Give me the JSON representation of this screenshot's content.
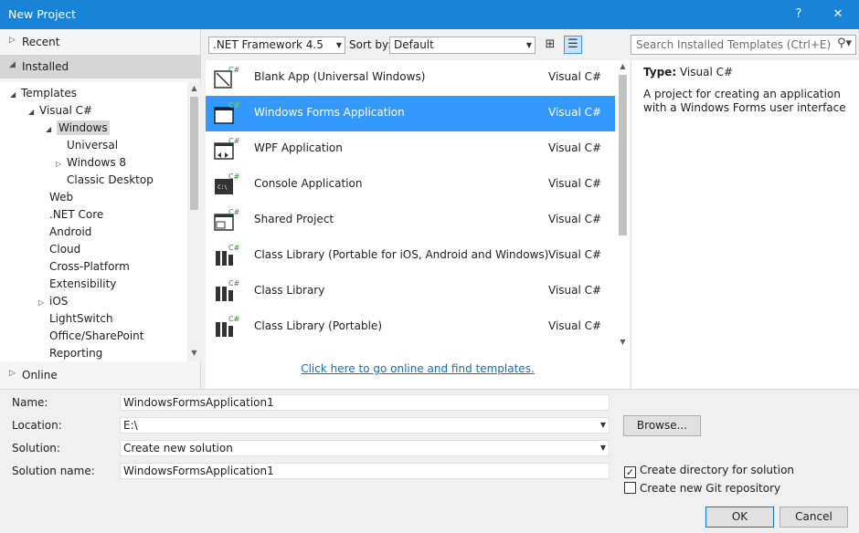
{
  "window": {
    "title": "New Project",
    "help": "?",
    "close": "✕"
  },
  "left": {
    "recent": "Recent",
    "installed": "Installed",
    "online": "Online",
    "tree": [
      {
        "label": "Templates",
        "arrow": "◢"
      },
      {
        "label": "Visual C#",
        "arrow": "◢"
      },
      {
        "label": "Windows",
        "arrow": "◢"
      },
      {
        "label": "Universal",
        "arrow": ""
      },
      {
        "label": "Windows 8",
        "arrow": "▷"
      },
      {
        "label": "Classic Desktop",
        "arrow": ""
      },
      {
        "label": "Web",
        "arrow": ""
      },
      {
        "label": ".NET Core",
        "arrow": ""
      },
      {
        "label": "Android",
        "arrow": ""
      },
      {
        "label": "Cloud",
        "arrow": ""
      },
      {
        "label": "Cross-Platform",
        "arrow": ""
      },
      {
        "label": "Extensibility",
        "arrow": ""
      },
      {
        "label": "iOS",
        "arrow": "▷"
      },
      {
        "label": "LightSwitch",
        "arrow": ""
      },
      {
        "label": "Office/SharePoint",
        "arrow": ""
      },
      {
        "label": "Reporting",
        "arrow": ""
      }
    ]
  },
  "toolbar": {
    "framework": ".NET Framework 4.5",
    "sort_label": "Sort by:",
    "sort_value": "Default"
  },
  "search": {
    "placeholder": "Search Installed Templates (Ctrl+E)"
  },
  "templates": [
    {
      "name": "Blank App (Universal Windows)",
      "lang": "Visual C#"
    },
    {
      "name": "Windows Forms Application",
      "lang": "Visual C#"
    },
    {
      "name": "WPF Application",
      "lang": "Visual C#"
    },
    {
      "name": "Console Application",
      "lang": "Visual C#"
    },
    {
      "name": "Shared Project",
      "lang": "Visual C#"
    },
    {
      "name": "Class Library (Portable for iOS, Android and Windows)",
      "lang": "Visual C#"
    },
    {
      "name": "Class Library",
      "lang": "Visual C#"
    },
    {
      "name": "Class Library (Portable)",
      "lang": "Visual C#"
    }
  ],
  "online_link": "Click here to go online and find templates.",
  "details": {
    "type_label": "Type:",
    "type_value": "Visual C#",
    "description": "A project for creating an application with a Windows Forms user interface"
  },
  "form": {
    "name_label": "Name:",
    "name_value": "WindowsFormsApplication1",
    "location_label": "Location:",
    "location_value": "E:\\",
    "solution_label": "Solution:",
    "solution_value": "Create new solution",
    "solution_name_label": "Solution name:",
    "solution_name_value": "WindowsFormsApplication1",
    "browse": "Browse...",
    "create_dir": "Create directory for solution",
    "create_dir_checked": true,
    "create_git": "Create new Git repository",
    "create_git_checked": false,
    "ok": "OK",
    "cancel": "Cancel"
  },
  "icon_badge": "C#",
  "colors": {
    "titlebar": "#1883d7",
    "selection": "#3399ff",
    "link": "#0e70c0"
  }
}
